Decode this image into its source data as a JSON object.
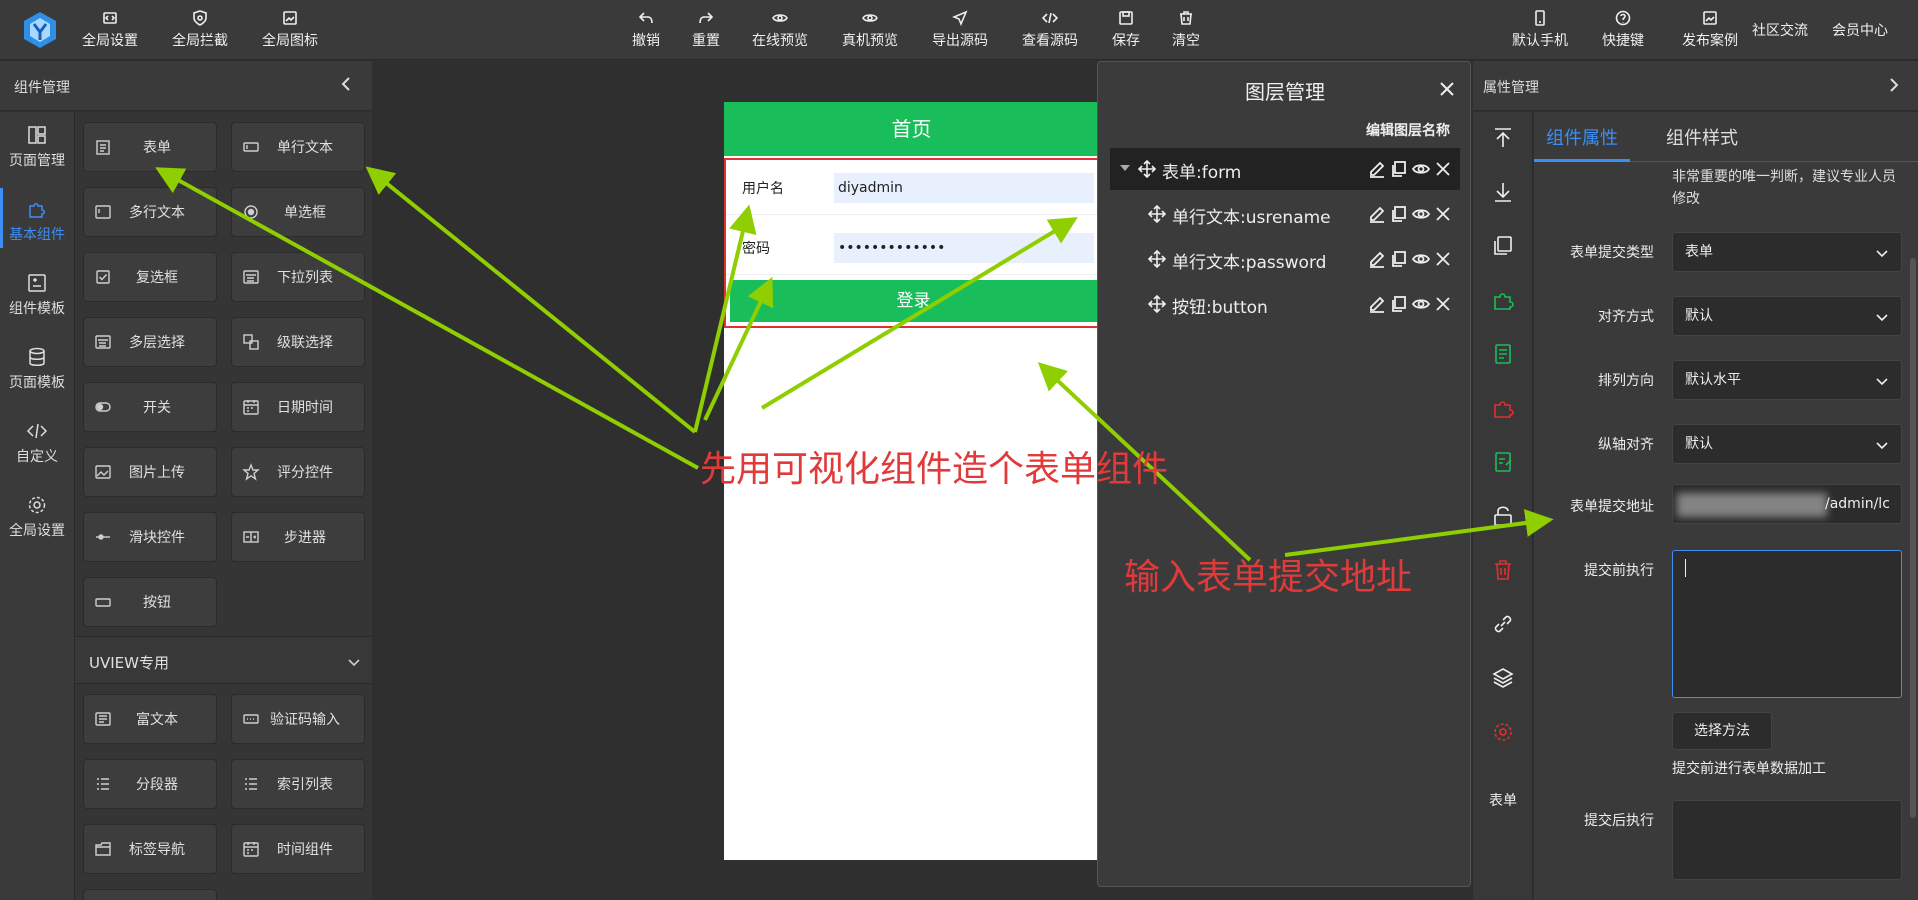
{
  "toolbar": {
    "left": [
      {
        "label": "全局设置",
        "icon": "code-settings-icon"
      },
      {
        "label": "全局拦截",
        "icon": "shield-icon"
      },
      {
        "label": "全局图标",
        "icon": "image-icon"
      }
    ],
    "center": [
      {
        "label": "撤销",
        "icon": "undo-icon"
      },
      {
        "label": "重置",
        "icon": "redo-icon"
      },
      {
        "label": "在线预览",
        "icon": "eye-icon"
      },
      {
        "label": "真机预览",
        "icon": "eye-icon"
      },
      {
        "label": "导出源码",
        "icon": "send-icon"
      },
      {
        "label": "查看源码",
        "icon": "code-icon"
      },
      {
        "label": "保存",
        "icon": "save-icon"
      },
      {
        "label": "清空",
        "icon": "trash-icon"
      }
    ],
    "right": [
      {
        "label": "默认手机",
        "icon": "phone-icon"
      },
      {
        "label": "快捷键",
        "icon": "help-icon"
      },
      {
        "label": "发布案例",
        "icon": "image-icon"
      },
      {
        "label": "社区交流"
      },
      {
        "label": "会员中心"
      }
    ]
  },
  "left_panel": {
    "title": "组件管理",
    "nav": [
      {
        "label": "页面管理",
        "icon": "layout-icon"
      },
      {
        "label": "基本组件",
        "icon": "puzzle-icon",
        "active": true
      },
      {
        "label": "组件模板",
        "icon": "template-icon"
      },
      {
        "label": "页面模板",
        "icon": "database-icon"
      },
      {
        "label": "自定义",
        "icon": "code-icon"
      },
      {
        "label": "全局设置",
        "icon": "gear-icon"
      }
    ],
    "components": [
      "表单",
      "单行文本",
      "多行文本",
      "单选框",
      "复选框",
      "下拉列表",
      "多层选择",
      "级联选择",
      "开关",
      "日期时间",
      "图片上传",
      "评分控件",
      "滑块控件",
      "步进器",
      "按钮"
    ],
    "uview_title": "UVIEW专用",
    "uview_components": [
      "富文本",
      "验证码输入",
      "分段器",
      "索引列表",
      "标签导航",
      "时间组件"
    ]
  },
  "phone": {
    "title": "首页",
    "fields": [
      {
        "label": "用户名",
        "value": "diyadmin"
      },
      {
        "label": "密码",
        "value": "•••••••••••••"
      }
    ],
    "button": "登录"
  },
  "layers": {
    "title": "图层管理",
    "subtitle": "编辑图层名称",
    "items": [
      {
        "name": "表单:form",
        "selected": true
      },
      {
        "name": "单行文本:usrename"
      },
      {
        "name": "单行文本:password"
      },
      {
        "name": "按钮:button"
      }
    ]
  },
  "props": {
    "title": "属性管理",
    "tabs": [
      "组件属性",
      "组件样式"
    ],
    "hint": "非常重要的唯一判断，建议专业人员修改",
    "fields": [
      {
        "label": "表单提交类型",
        "value": "表单"
      },
      {
        "label": "对齐方式",
        "value": "默认"
      },
      {
        "label": "排列方向",
        "value": "默认水平"
      },
      {
        "label": "纵轴对齐",
        "value": "默认"
      }
    ],
    "url_label": "表单提交地址",
    "url_value": "/admin/lc",
    "before_label": "提交前执行",
    "method_button": "选择方法",
    "method_hint": "提交前进行表单数据加工",
    "after_label": "提交后执行",
    "side_label": "表单"
  },
  "annotations": {
    "text1": "先用可视化组件造个表单组件",
    "text2": "输入表单提交地址",
    "color": "#e03a3a",
    "arrow_color": "#8fce00"
  },
  "colors": {
    "accent": "#3d8ef5",
    "green": "#19be5a",
    "red": "#e03030"
  }
}
